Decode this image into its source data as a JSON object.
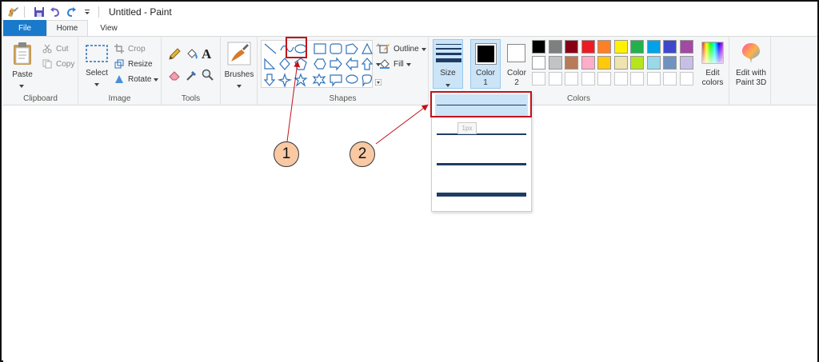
{
  "window": {
    "title": "Untitled - Paint"
  },
  "tabs": {
    "file": "File",
    "home": "Home",
    "view": "View"
  },
  "clipboard": {
    "paste": "Paste",
    "cut": "Cut",
    "copy": "Copy",
    "label": "Clipboard"
  },
  "image": {
    "select": "Select",
    "crop": "Crop",
    "resize": "Resize",
    "rotate": "Rotate",
    "label": "Image"
  },
  "tools": {
    "label": "Tools",
    "text_glyph": "A"
  },
  "brushes": {
    "label": "Brushes"
  },
  "shapes": {
    "outline": "Outline",
    "fill": "Fill",
    "label": "Shapes"
  },
  "size": {
    "label": "Size",
    "tooltip": "1px"
  },
  "colors": {
    "color1_label": "Color",
    "color1_num": "1",
    "color2_label": "Color",
    "color2_num": "2",
    "color1_value": "#000000",
    "color2_value": "#ffffff",
    "edit_colors_line1": "Edit",
    "edit_colors_line2": "colors",
    "edit_3d_line1": "Edit with",
    "edit_3d_line2": "Paint 3D",
    "label": "Colors",
    "palette_row1": [
      "#000000",
      "#7f7f7f",
      "#880015",
      "#ed1c24",
      "#ff7f27",
      "#fff200",
      "#22b14c",
      "#00a2e8",
      "#3f48cc",
      "#a349a4"
    ],
    "palette_row2": [
      "#ffffff",
      "#c3c3c3",
      "#b97a57",
      "#ffaec9",
      "#ffc90e",
      "#efe4b0",
      "#b5e61d",
      "#99d9ea",
      "#7092be",
      "#c8bfe7"
    ]
  },
  "callouts": {
    "one": "1",
    "two": "2"
  }
}
